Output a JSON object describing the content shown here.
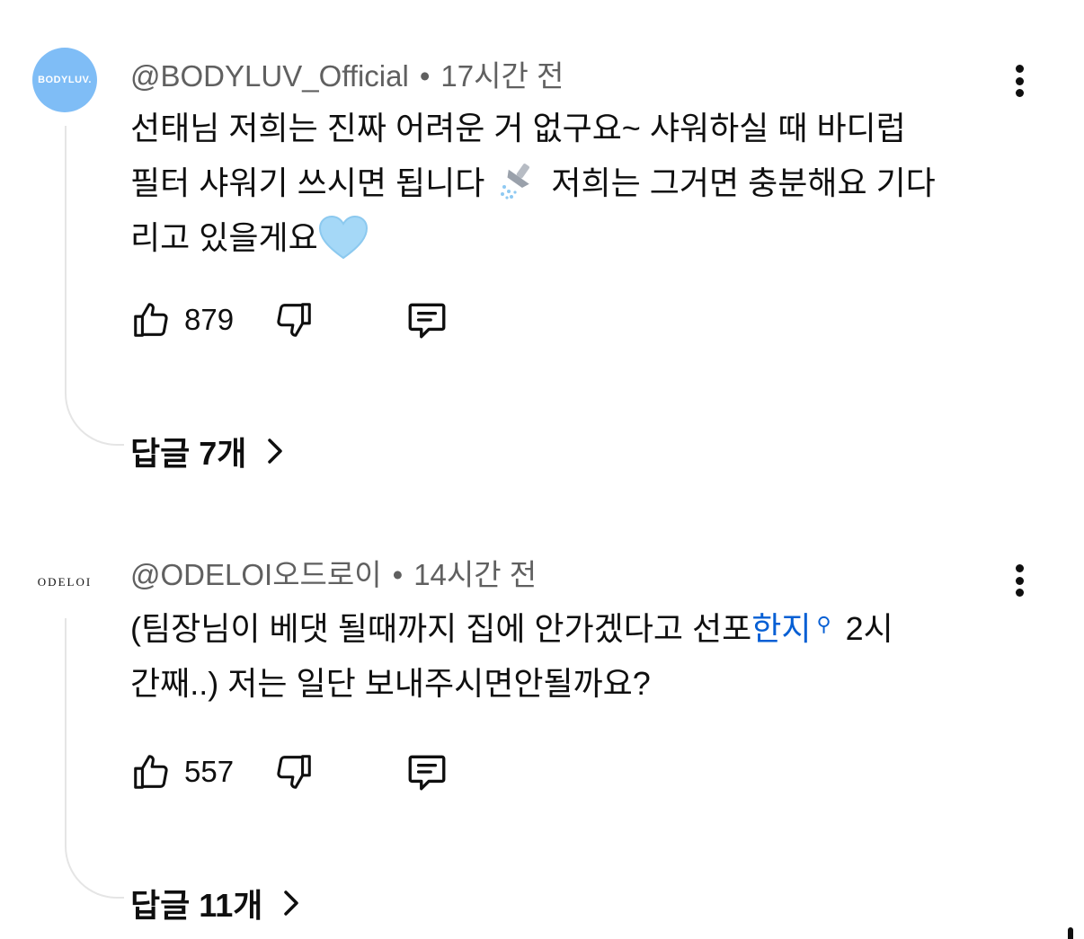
{
  "comments": [
    {
      "avatar_text": "BODYLUV.",
      "author": "@BODYLUV_Official",
      "time": "17시간 전",
      "line1": "선태님 저희는 진짜 어려운 거 없구요~ 샤워하실 때 바디럽",
      "line2a": "필터 샤워기 쓰시면 됩니다",
      "line2_icon": "shower-emoji",
      "line2b": "저희는 그거면 충분해요 기다",
      "line3": "리고 있을게요",
      "line3_icon": "light-blue-heart-emoji",
      "likes": "879",
      "replies_label": "답글 7개"
    },
    {
      "avatar_text": "ODELOI",
      "author": "@ODELOI오드로이",
      "time": "14시간 전",
      "line1a": "(팀장님이 베댓 될때까지 집에 안가겠다고 선포",
      "line1_link": "한지",
      "line1_icon": "search-magnifier-icon",
      "line1b": "2시",
      "line2": "간째..) 저는 일단 보내주시면안될까요?",
      "likes": "557",
      "replies_label": "답글 11개"
    }
  ],
  "colors": {
    "accent_link": "#065fd4",
    "avatar_bodyluv": "#7fbdf6",
    "meta_gray": "#606060",
    "thread_line": "#e5e5e5"
  }
}
